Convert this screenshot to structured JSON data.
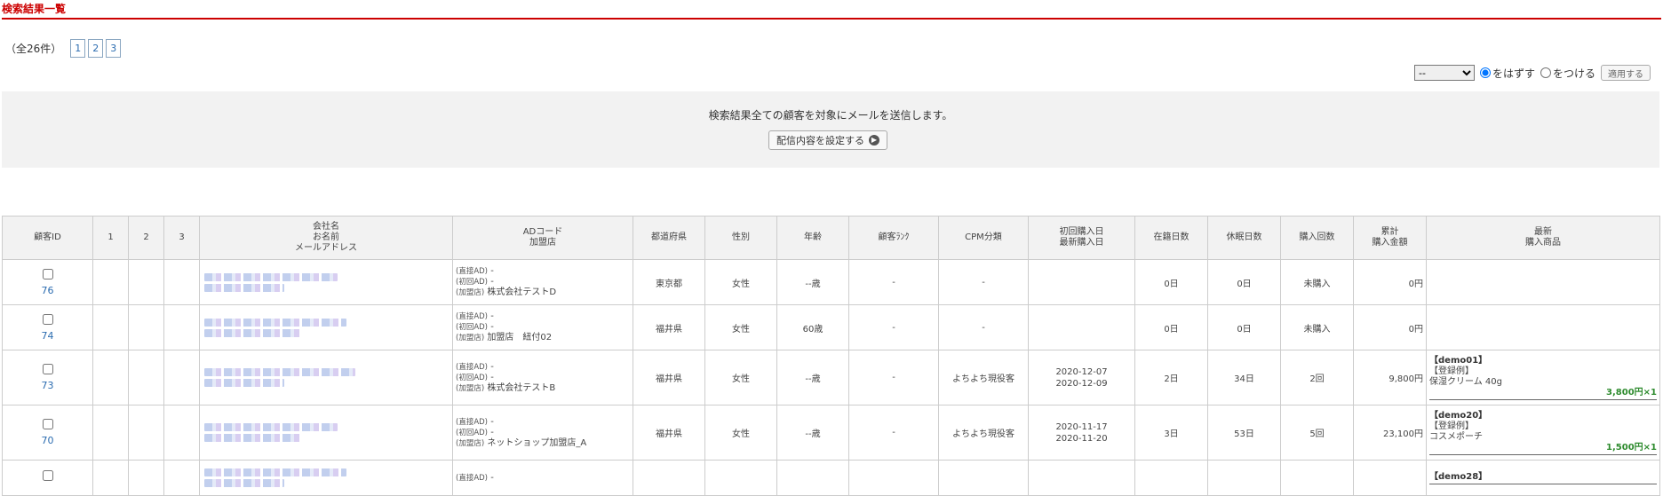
{
  "page": {
    "title": "検索結果一覧"
  },
  "pager": {
    "total": "（全26件）",
    "pages": [
      "1",
      "2",
      "3"
    ]
  },
  "mail_tool": {
    "select_value": "--",
    "radio1": "をはずす",
    "radio2": "をつける",
    "apply": "適用する"
  },
  "mail_box": {
    "message": "検索結果全ての顧客を対象にメールを送信します。",
    "button": "配信内容を設定する"
  },
  "icons": {
    "config_button_icon": "circle-arrow-right-icon"
  },
  "table": {
    "headers": {
      "id": "顧客ID",
      "c1": "1",
      "c2": "2",
      "c3": "3",
      "company_1": "会社名",
      "company_2": "お名前",
      "company_3": "メールアドレス",
      "ad_1": "ADコード",
      "ad_2": "加盟店",
      "pref": "都道府県",
      "gender": "性別",
      "age": "年齢",
      "rank": "顧客ﾗﾝｸ",
      "cpm": "CPM分類",
      "date_1": "初回購入日",
      "date_2": "最新購入日",
      "enroll": "在籍日数",
      "dormant": "休眠日数",
      "count": "購入回数",
      "amount_1": "累計",
      "amount_2": "購入金額",
      "product_1": "最新",
      "product_2": "購入商品"
    },
    "ad_labels": {
      "direct": "(直接AD)",
      "first": "(初回AD)",
      "shop": "(加盟店)"
    },
    "rows": [
      {
        "id": "76",
        "ad_direct": "-",
        "ad_first": "-",
        "shop": "株式会社テストD",
        "pref": "東京都",
        "gender": "女性",
        "age": "--歳",
        "rank": "-",
        "cpm": "-",
        "first_date": "",
        "last_date": "",
        "enroll": "0日",
        "dormant": "0日",
        "count": "未購入",
        "amount": "0円",
        "product": null
      },
      {
        "id": "74",
        "ad_direct": "-",
        "ad_first": "-",
        "shop": "加盟店　紐付02",
        "pref": "福井県",
        "gender": "女性",
        "age": "60歳",
        "rank": "-",
        "cpm": "-",
        "first_date": "",
        "last_date": "",
        "enroll": "0日",
        "dormant": "0日",
        "count": "未購入",
        "amount": "0円",
        "product": null
      },
      {
        "id": "73",
        "ad_direct": "-",
        "ad_first": "-",
        "shop": "株式会社テストB",
        "pref": "福井県",
        "gender": "女性",
        "age": "--歳",
        "rank": "-",
        "cpm": "よちよち現役客",
        "first_date": "2020-12-07",
        "last_date": "2020-12-09",
        "enroll": "2日",
        "dormant": "34日",
        "count": "2回",
        "amount": "9,800円",
        "product": {
          "code": "【demo01】",
          "tag": "【登録例】",
          "name": "保湿クリーム 40g",
          "price": "3,800円×1"
        }
      },
      {
        "id": "70",
        "ad_direct": "-",
        "ad_first": "-",
        "shop": "ネットショップ加盟店_A",
        "pref": "福井県",
        "gender": "女性",
        "age": "--歳",
        "rank": "-",
        "cpm": "よちよち現役客",
        "first_date": "2020-11-17",
        "last_date": "2020-11-20",
        "enroll": "3日",
        "dormant": "53日",
        "count": "5回",
        "amount": "23,100円",
        "product": {
          "code": "【demo20】",
          "tag": "【登録例】",
          "name": "コスメポーチ",
          "price": "1,500円×1"
        }
      },
      {
        "id": "",
        "ad_direct": "-",
        "ad_first": "",
        "shop": "",
        "pref": "",
        "gender": "",
        "age": "",
        "rank": "",
        "cpm": "",
        "first_date": "",
        "last_date": "",
        "enroll": "",
        "dormant": "",
        "count": "",
        "amount": "",
        "product": {
          "code": "【demo28】",
          "tag": "",
          "name": "",
          "price": ""
        }
      }
    ]
  }
}
